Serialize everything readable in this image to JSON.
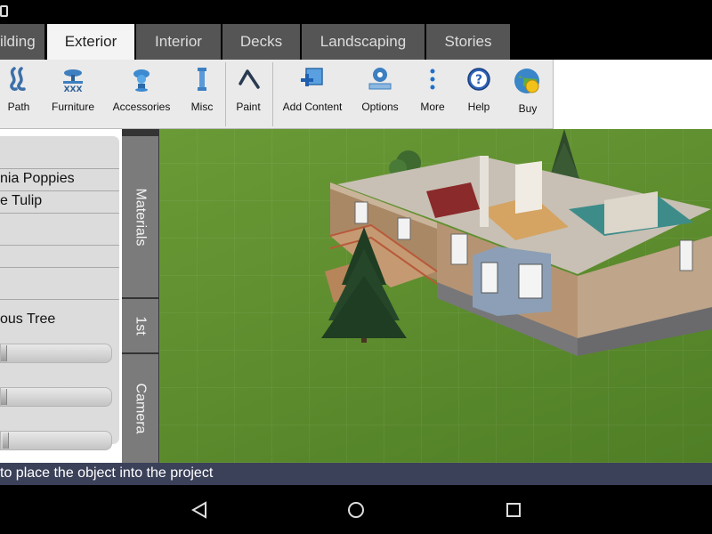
{
  "tabs": [
    {
      "label": "ilding",
      "active": false
    },
    {
      "label": "Exterior",
      "active": true
    },
    {
      "label": "Interior",
      "active": false
    },
    {
      "label": "Decks",
      "active": false
    },
    {
      "label": "Landscaping",
      "active": false
    },
    {
      "label": "Stories",
      "active": false
    }
  ],
  "toolbar": {
    "items": [
      {
        "label": "Path",
        "icon": "path-icon"
      },
      {
        "label": "Furniture",
        "icon": "furniture-icon"
      },
      {
        "label": "Accessories",
        "icon": "accessories-icon"
      },
      {
        "label": "Misc",
        "icon": "misc-icon"
      },
      {
        "label": "Paint",
        "icon": "paint-icon"
      },
      {
        "label": "Add Content",
        "icon": "add-content-icon"
      },
      {
        "label": "Options",
        "icon": "options-icon"
      },
      {
        "label": "More",
        "icon": "more-icon"
      },
      {
        "label": "Help",
        "icon": "help-icon"
      },
      {
        "label": "Buy",
        "icon": "buy-icon"
      }
    ]
  },
  "object_list": {
    "items": [
      "",
      "nia Poppies",
      "e Tulip",
      "",
      "",
      "",
      "ous Tree"
    ]
  },
  "side_tabs": [
    "Materials",
    "1st",
    "Camera"
  ],
  "sliders": [
    {
      "value": 0.0
    },
    {
      "value": 0.0
    },
    {
      "value": 0.02
    }
  ],
  "hint": "to place the object into the project",
  "colors": {
    "active_tab": "#f4f4f4",
    "inactive_tab": "#555555",
    "grass": "#5d8e2f",
    "hint_bar": "#3c415a"
  }
}
